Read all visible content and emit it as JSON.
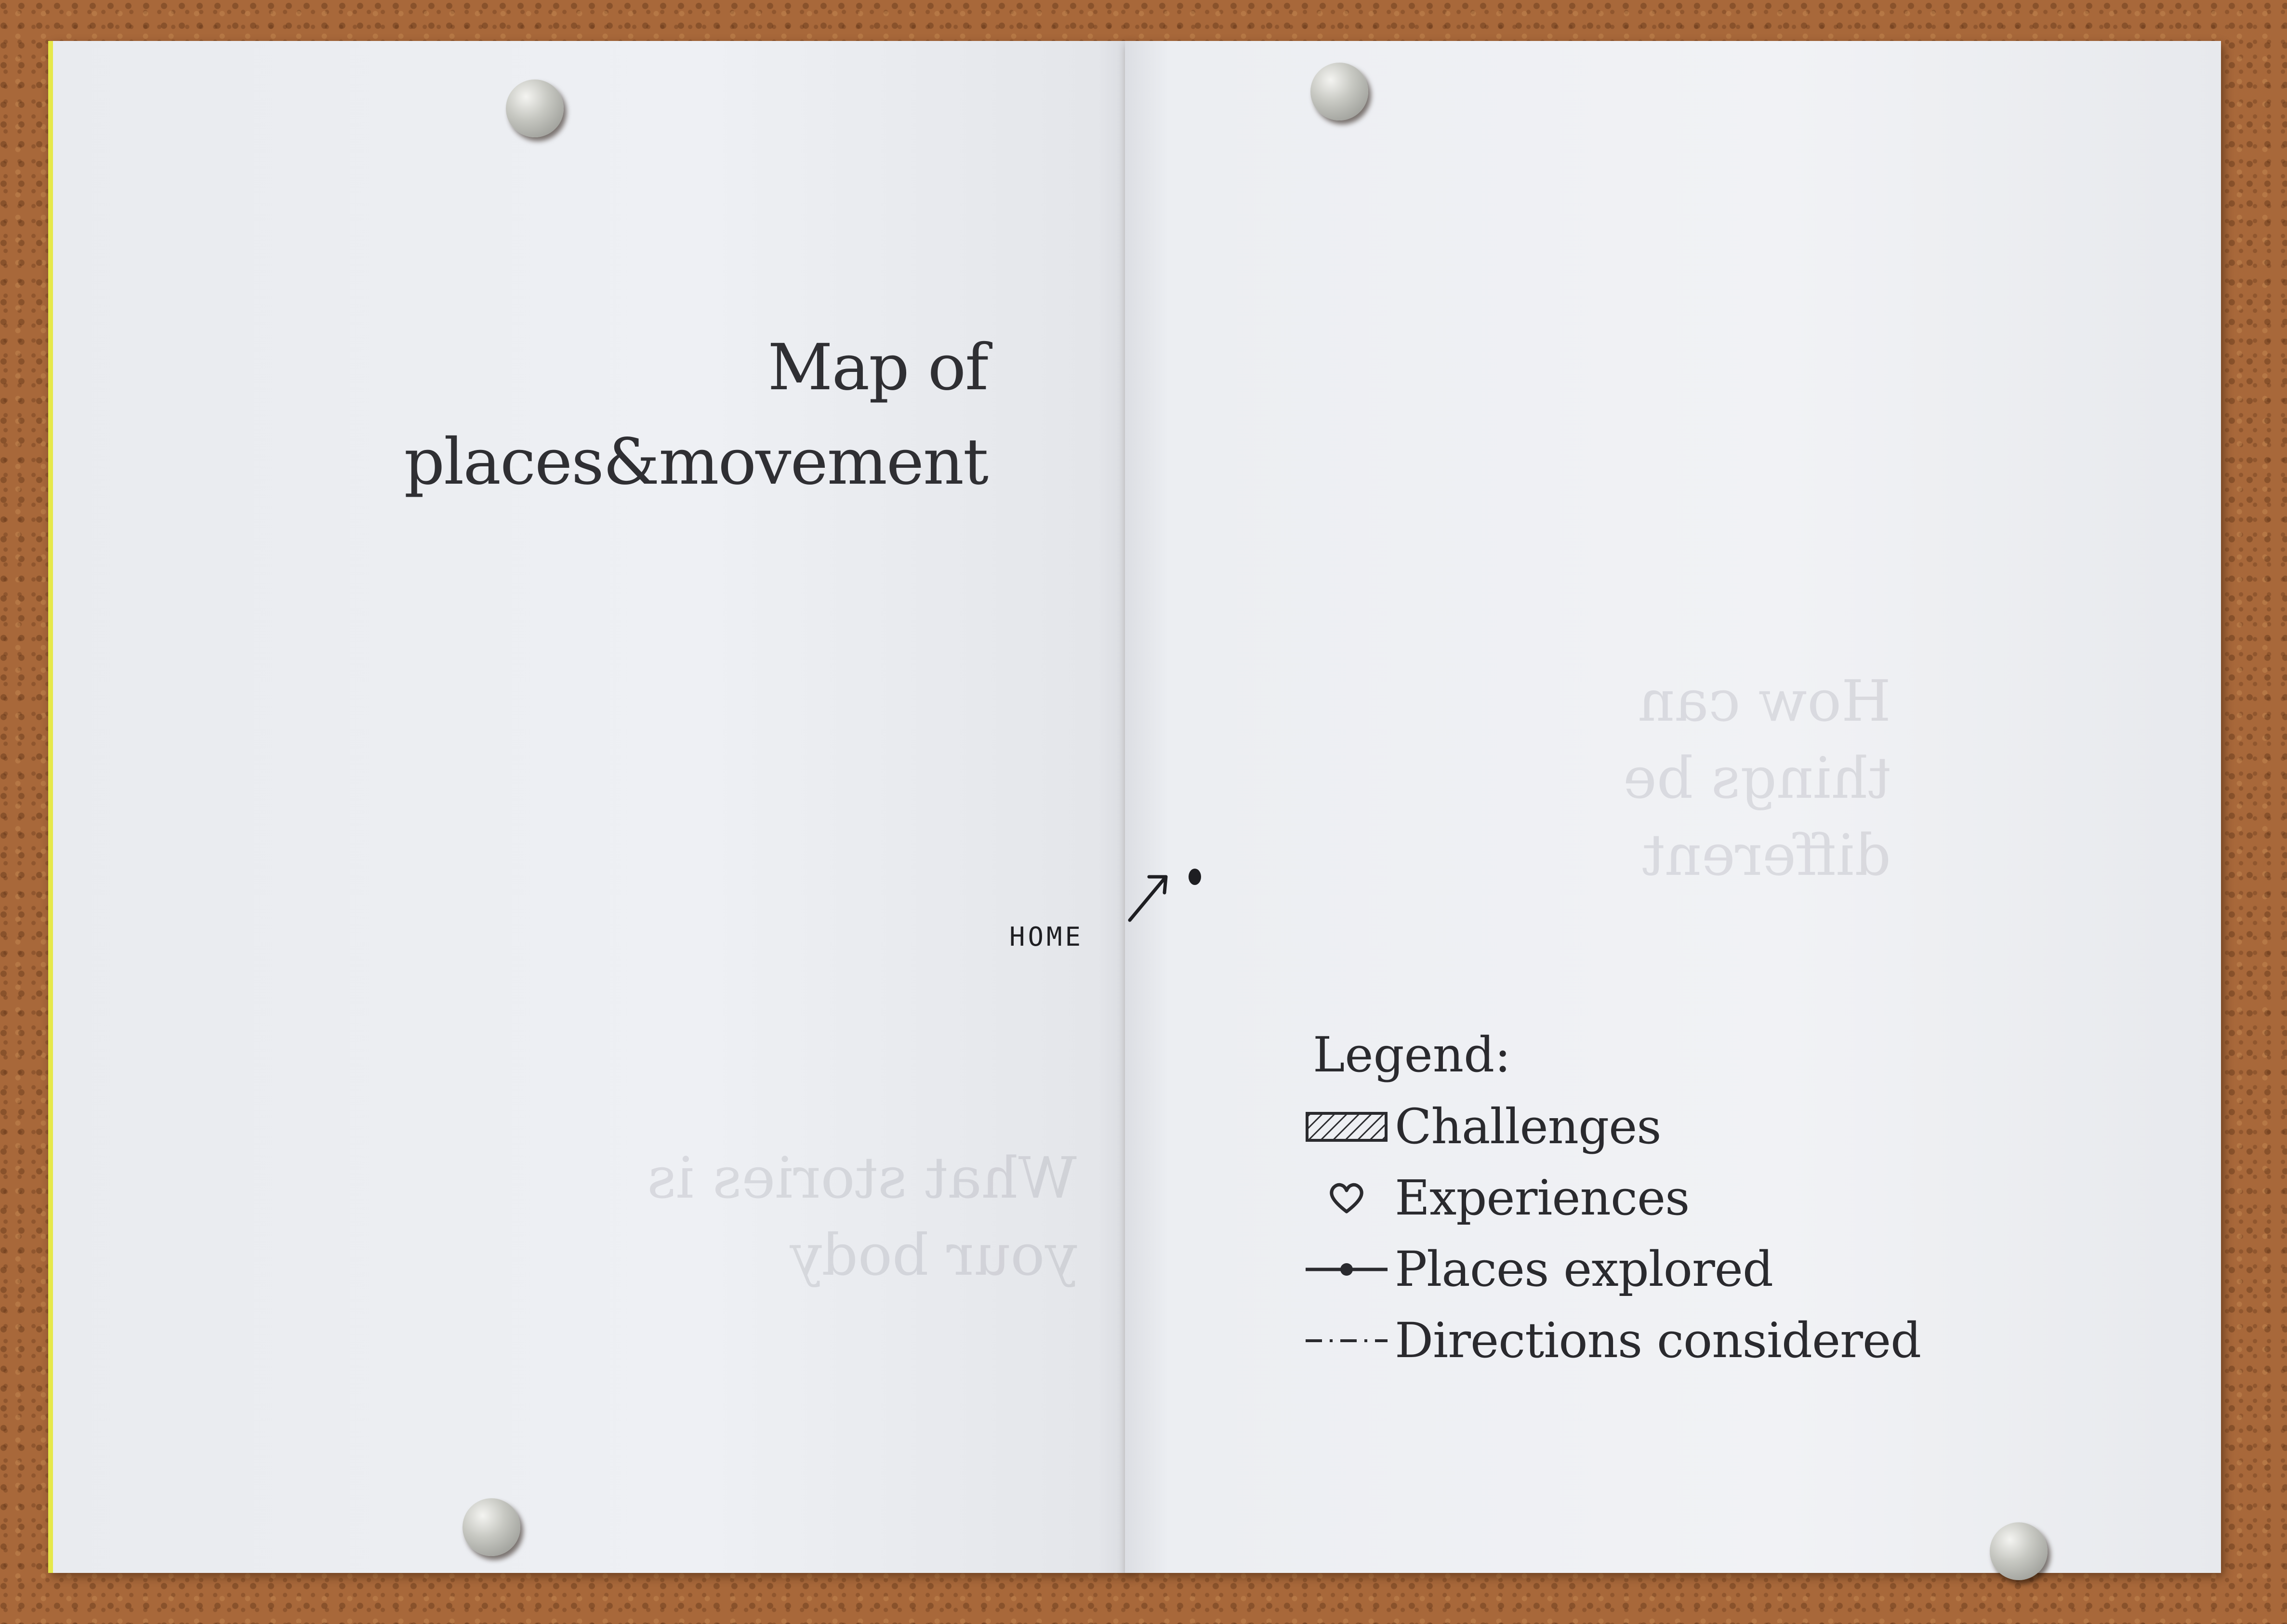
{
  "booklet": {
    "title_line1": "Map of",
    "title_line2": "places&movement",
    "bleed_text_left": "What stories is your body",
    "bleed_text_right": "How can things be different",
    "home_label": "HOME"
  },
  "legend": {
    "title": "Legend:",
    "items": [
      {
        "label": "Challenges",
        "icon": "hatched-box-icon"
      },
      {
        "label": "Experiences",
        "icon": "heart-icon"
      },
      {
        "label": "Places explored",
        "icon": "line-dot-line-icon"
      },
      {
        "label": "Directions considered",
        "icon": "dash-dot-line-icon"
      }
    ]
  },
  "colors": {
    "paper": "#eceef2",
    "ink": "#2a2a2e",
    "cork": "#a8683a",
    "cover_edge": "#e6e84a"
  }
}
